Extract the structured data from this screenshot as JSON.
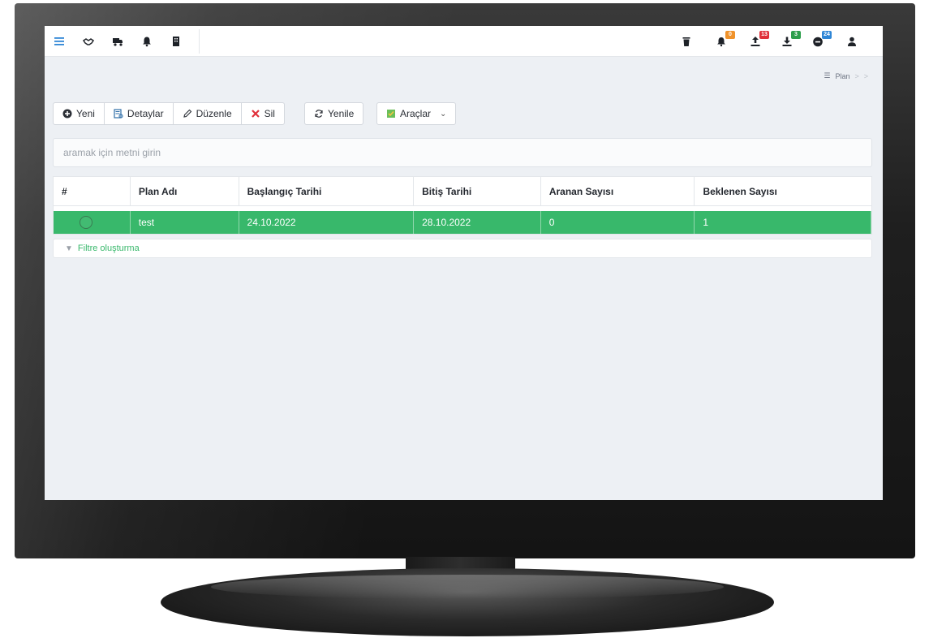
{
  "colors": {
    "accent": "#38b86b",
    "badge_orange": "#f0932b",
    "badge_red": "#e0303a",
    "badge_green": "#2d9e4b",
    "badge_blue": "#2f86d6"
  },
  "topbar": {
    "left_icons": [
      "menu-icon",
      "handshake-icon",
      "truck-icon",
      "bell-icon",
      "building-icon"
    ],
    "right_icons": [
      {
        "icon": "trash-icon",
        "badge": ""
      },
      {
        "icon": "notification-bell-icon",
        "badge": "0"
      },
      {
        "icon": "upload-icon",
        "badge": "13"
      },
      {
        "icon": "download-icon",
        "badge": "3"
      },
      {
        "icon": "minus-circle-icon",
        "badge": "24"
      },
      {
        "icon": "user-icon",
        "badge": ""
      }
    ]
  },
  "breadcrumb": {
    "label": "Plan",
    "sep1": ">",
    "sep2": ">"
  },
  "toolbar": {
    "new": "Yeni",
    "details": "Detaylar",
    "edit": "Düzenle",
    "delete": "Sil",
    "refresh": "Yenile",
    "tools": "Araçlar"
  },
  "search": {
    "placeholder": "aramak için metni girin"
  },
  "table": {
    "columns": [
      "#",
      "Plan Adı",
      "Başlangıç Tarihi",
      "Bitiş Tarihi",
      "Aranan Sayısı",
      "Beklenen Sayısı"
    ],
    "rows": [
      {
        "name": "test",
        "start": "24.10.2022",
        "end": "28.10.2022",
        "called": "0",
        "expected": "1"
      }
    ]
  },
  "filter": {
    "label": "Filtre oluşturma"
  }
}
